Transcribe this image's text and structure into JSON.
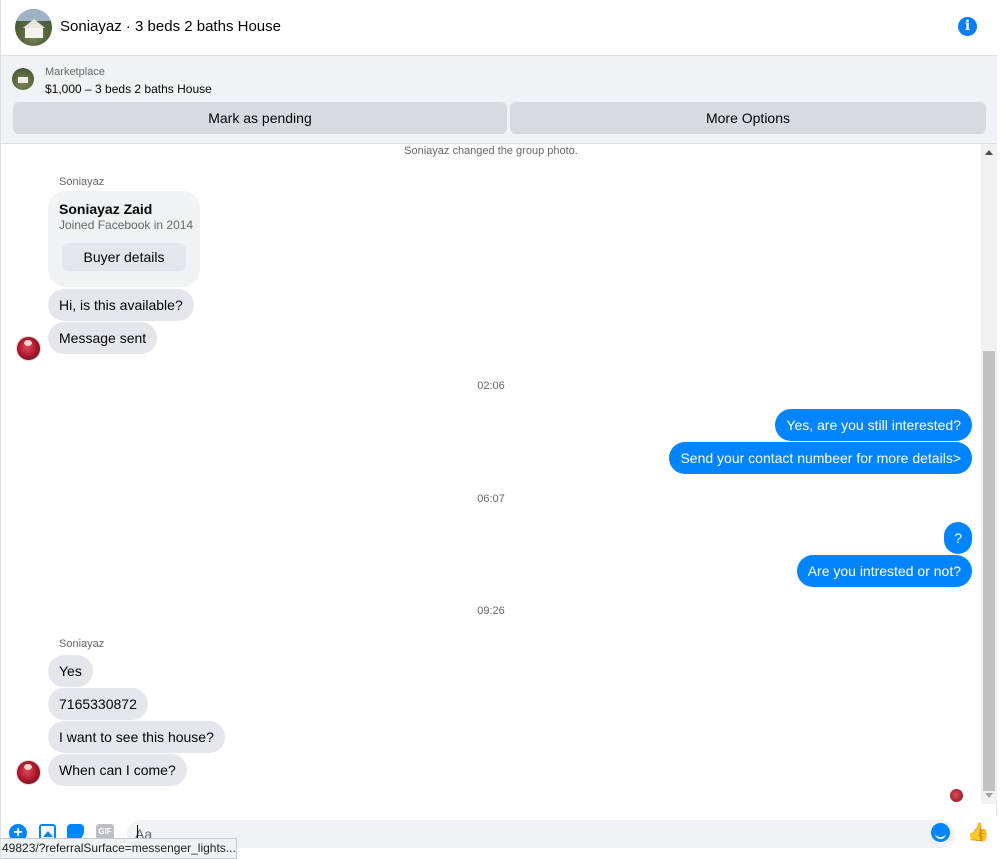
{
  "header": {
    "title": "Soniayaz · 3 beds 2 baths House",
    "info_icon": "info-icon"
  },
  "marketplace": {
    "label": "Marketplace",
    "listing": "$1,000 – 3 beds 2 baths House",
    "mark_pending_label": "Mark as pending",
    "more_options_label": "More Options"
  },
  "chat": {
    "system_notice": "Soniayaz changed the group photo.",
    "sender_name": "Soniayaz",
    "buyer_card": {
      "name": "Soniayaz Zaid",
      "joined": "Joined Facebook in 2014",
      "button_label": "Buyer details"
    },
    "messages": [
      {
        "dir": "in",
        "text": "Hi, is this available?"
      },
      {
        "dir": "in",
        "text": "Message sent"
      },
      {
        "time": "02:06"
      },
      {
        "dir": "out",
        "text": "Yes, are you still interested?"
      },
      {
        "dir": "out",
        "text": "Send your contact numbeer for more details>"
      },
      {
        "time": "06:07"
      },
      {
        "dir": "out",
        "text": "?"
      },
      {
        "dir": "out",
        "text": "Are you intrested or not?"
      },
      {
        "time": "09:26"
      },
      {
        "dir": "in",
        "text": "Yes"
      },
      {
        "dir": "in",
        "text": "7165330872"
      },
      {
        "dir": "in",
        "text": "I want to see this house?"
      },
      {
        "dir": "in",
        "text": "When can I come?"
      }
    ]
  },
  "composer": {
    "placeholder": "Aa",
    "gif_label": "GIF",
    "plus_label": "+",
    "like_icon": "👍"
  },
  "status_bar": {
    "url": "49823/?referralSurface=messenger_lights..."
  },
  "colors": {
    "accent": "#0084ff",
    "incoming_bubble": "#e4e6eb",
    "banner_bg": "#f0f2f5"
  }
}
